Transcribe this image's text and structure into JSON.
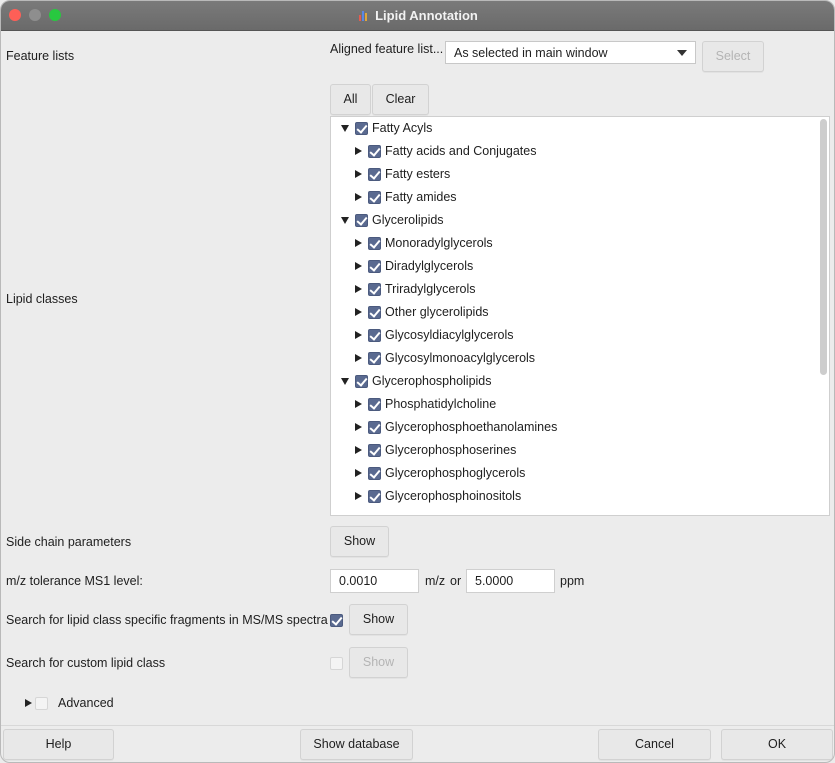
{
  "window": {
    "title": "Lipid Annotation"
  },
  "feature_lists": {
    "label": "Feature lists",
    "selector_label": "Aligned feature list...",
    "combo_value": "As selected in main window",
    "select_button": "Select"
  },
  "lipid_classes": {
    "label": "Lipid classes",
    "all_button": "All",
    "clear_button": "Clear",
    "tree": [
      {
        "level": 0,
        "label": "Fatty Acyls",
        "expanded": true,
        "checked": true
      },
      {
        "level": 1,
        "label": "Fatty acids and Conjugates",
        "expanded": false,
        "checked": true
      },
      {
        "level": 1,
        "label": "Fatty esters",
        "expanded": false,
        "checked": true
      },
      {
        "level": 1,
        "label": "Fatty amides",
        "expanded": false,
        "checked": true
      },
      {
        "level": 0,
        "label": "Glycerolipids",
        "expanded": true,
        "checked": true
      },
      {
        "level": 1,
        "label": "Monoradylglycerols",
        "expanded": false,
        "checked": true
      },
      {
        "level": 1,
        "label": "Diradylglycerols",
        "expanded": false,
        "checked": true
      },
      {
        "level": 1,
        "label": "Triradylglycerols",
        "expanded": false,
        "checked": true
      },
      {
        "level": 1,
        "label": "Other glycerolipids",
        "expanded": false,
        "checked": true
      },
      {
        "level": 1,
        "label": "Glycosyldiacylglycerols",
        "expanded": false,
        "checked": true
      },
      {
        "level": 1,
        "label": "Glycosylmonoacylglycerols",
        "expanded": false,
        "checked": true
      },
      {
        "level": 0,
        "label": "Glycerophospholipids",
        "expanded": true,
        "checked": true
      },
      {
        "level": 1,
        "label": "Phosphatidylcholine",
        "expanded": false,
        "checked": true
      },
      {
        "level": 1,
        "label": "Glycerophosphoethanolamines",
        "expanded": false,
        "checked": true
      },
      {
        "level": 1,
        "label": "Glycerophosphoserines",
        "expanded": false,
        "checked": true
      },
      {
        "level": 1,
        "label": "Glycerophosphoglycerols",
        "expanded": false,
        "checked": true
      },
      {
        "level": 1,
        "label": "Glycerophosphoinositols",
        "expanded": false,
        "checked": true
      }
    ]
  },
  "side_chain": {
    "label": "Side chain parameters",
    "show_button": "Show"
  },
  "mz_tolerance": {
    "label": "m/z tolerance MS1 level:",
    "mz_value": "0.0010",
    "mz_unit": "m/z",
    "or_text": "or",
    "ppm_value": "5.0000",
    "ppm_unit": "ppm"
  },
  "msms_search": {
    "label": "Search for lipid class specific fragments in MS/MS spectra",
    "checked": true,
    "show_button": "Show"
  },
  "custom_class": {
    "label": "Search for custom lipid class",
    "checked": false,
    "show_button": "Show"
  },
  "advanced": {
    "label": "Advanced",
    "checked": false
  },
  "footer": {
    "help": "Help",
    "show_database": "Show database",
    "cancel": "Cancel",
    "ok": "OK"
  },
  "colors": {
    "titlebar": "#707070",
    "close": "#fe5f57",
    "maximize": "#28c840",
    "checkbox": "#5a6a90",
    "window_bg": "#ececec"
  }
}
